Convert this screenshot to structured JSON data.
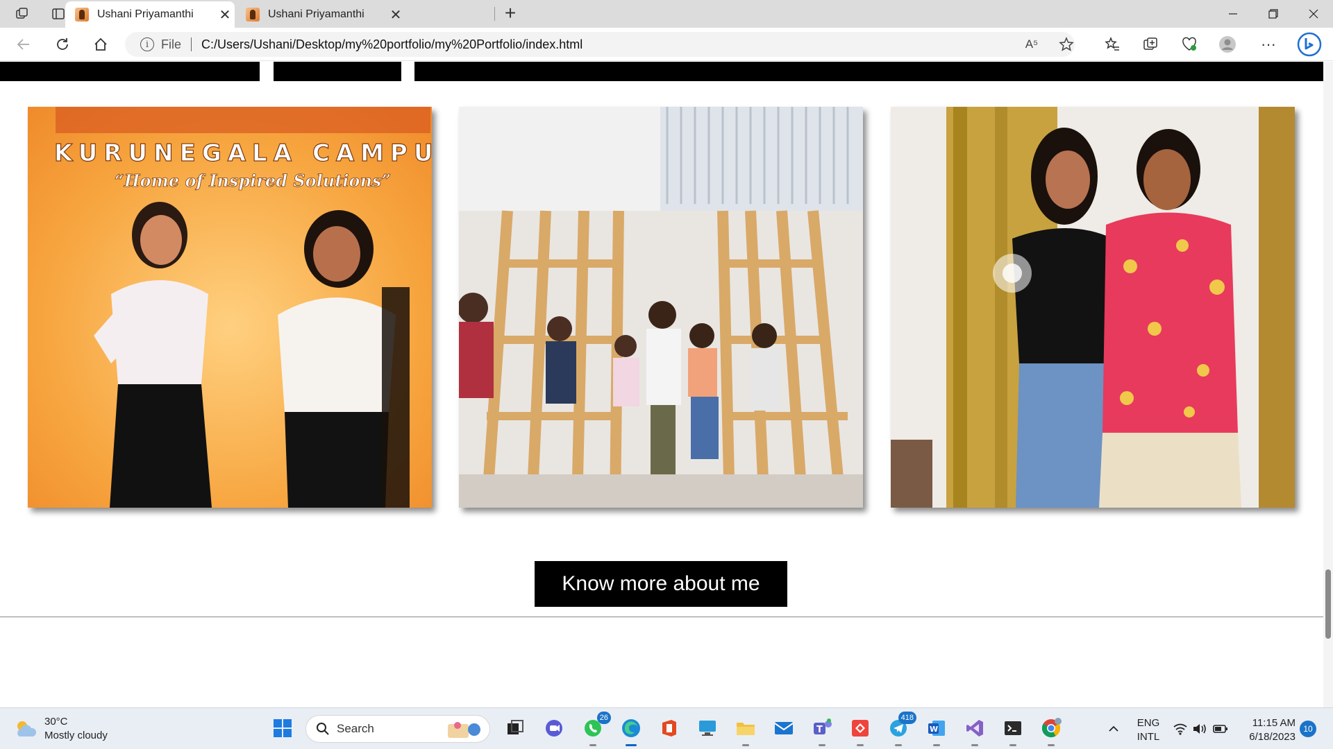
{
  "browser": {
    "tabs": [
      {
        "title": "Ushani Priyamanthi",
        "active": true
      },
      {
        "title": "Ushani Priyamanthi",
        "active": false
      }
    ],
    "address": {
      "scheme_label": "File",
      "url": "C:/Users/Ushani/Desktop/my%20portfolio/my%20Portfolio/index.html"
    },
    "read_aloud_label": "A⁵"
  },
  "page": {
    "photos": [
      {
        "sign_line1": "KURUNEGALA CAMPU",
        "sign_line2": "“Home of Inspired Solutions”"
      },
      {},
      {}
    ],
    "cta_label": "Know more about me"
  },
  "taskbar": {
    "weather": {
      "temp": "30°C",
      "condition": "Mostly cloudy"
    },
    "search_placeholder": "Search",
    "whatsapp_badge": "26",
    "telegram_badge": "418",
    "language": {
      "line1": "ENG",
      "line2": "INTL"
    },
    "clock": {
      "time": "11:15 AM",
      "date": "6/18/2023"
    },
    "notification_count": "10"
  },
  "colors": {
    "cta_bg": "#000000",
    "cta_text": "#ffffff",
    "taskbar_bg": "#e9eef5",
    "accent": "#0a64c8"
  }
}
